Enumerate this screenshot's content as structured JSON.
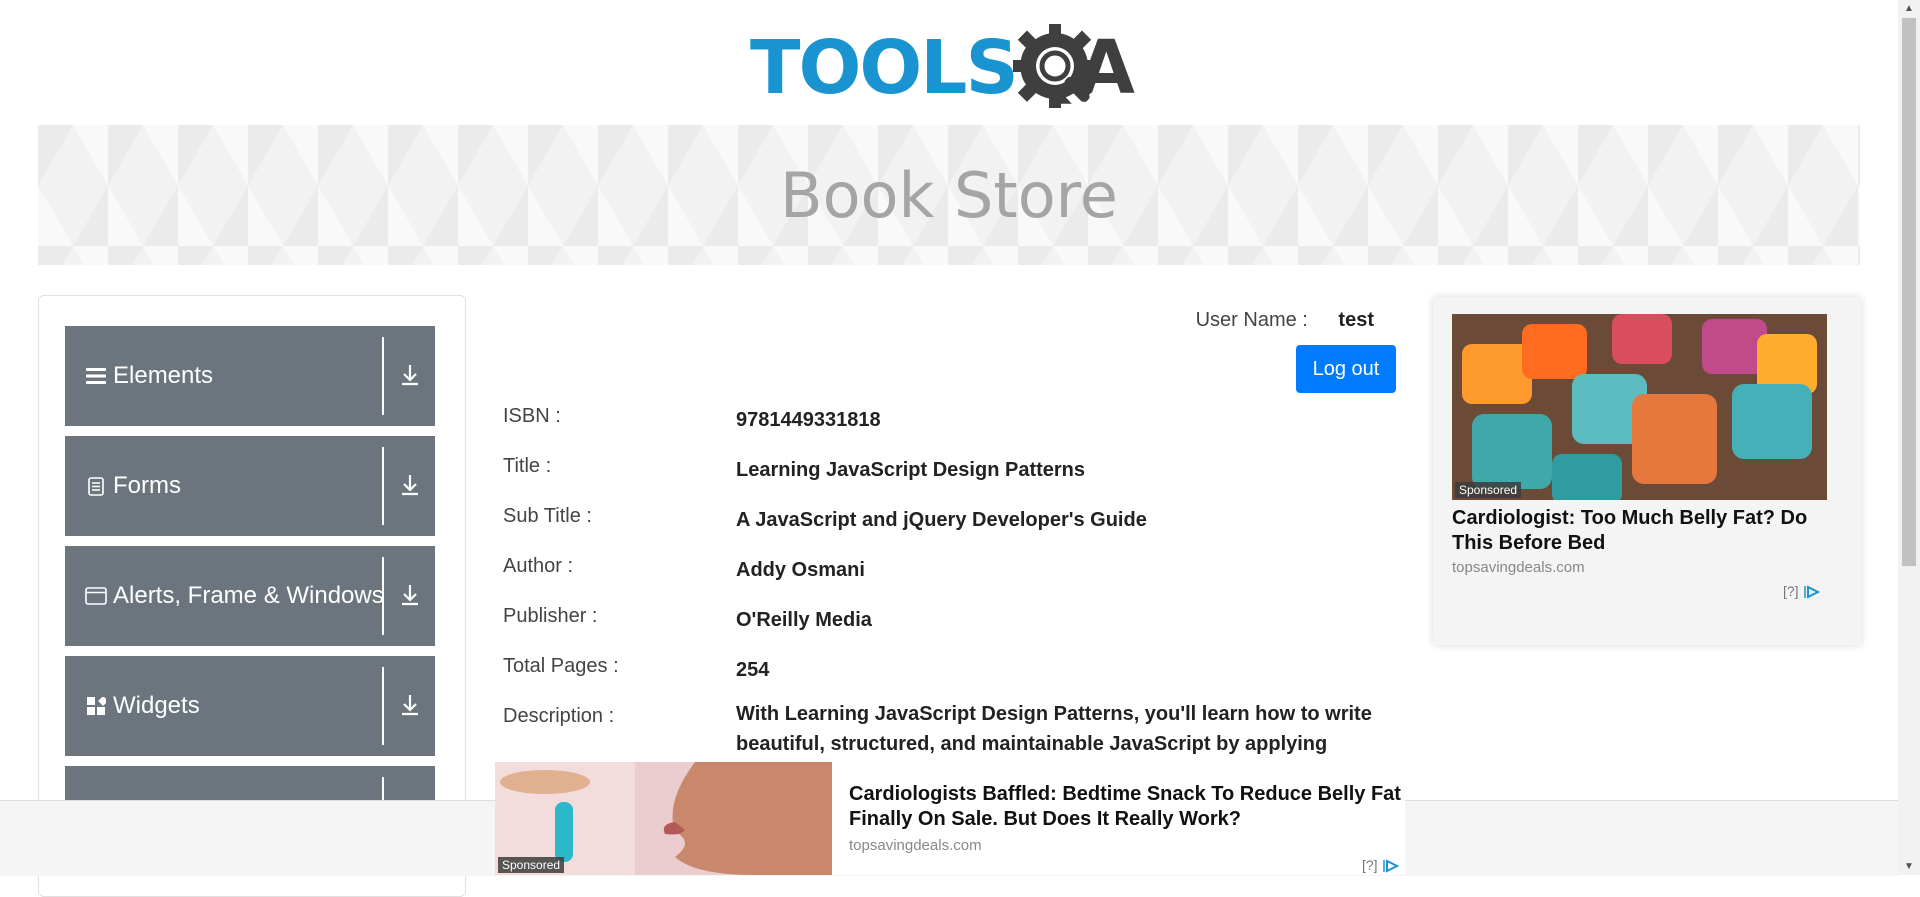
{
  "header": {
    "logo_text_main": "TOOLS",
    "logo_text_accent": "QA",
    "banner_title": "Book Store"
  },
  "sidebar": {
    "groups": [
      {
        "label": "Elements",
        "icon": "hamburger-icon"
      },
      {
        "label": "Forms",
        "icon": "document-icon"
      },
      {
        "label": "Alerts, Frame & Windows",
        "icon": "window-icon"
      },
      {
        "label": "Widgets",
        "icon": "widgets-icon"
      },
      {
        "label": "",
        "icon": ""
      }
    ]
  },
  "profile": {
    "username_label": "User Name :",
    "username_value": "test",
    "logout_label": "Log out"
  },
  "book": {
    "rows": [
      {
        "label": "ISBN :",
        "value": "9781449331818"
      },
      {
        "label": "Title :",
        "value": "Learning JavaScript Design Patterns"
      },
      {
        "label": "Sub Title :",
        "value": "A JavaScript and jQuery Developer's Guide"
      },
      {
        "label": "Author :",
        "value": "Addy Osmani"
      },
      {
        "label": "Publisher :",
        "value": "O'Reilly Media"
      },
      {
        "label": "Total Pages :",
        "value": "254"
      },
      {
        "label": "Description :",
        "value": "With Learning JavaScript Design Patterns, you'll learn how to write beautiful, structured, and maintainable JavaScript by applying classical"
      }
    ]
  },
  "ad_right": {
    "sponsored": "Sponsored",
    "title": "Cardiologist: Too Much Belly Fat? Do This Before Bed",
    "domain": "topsavingdeals.com",
    "info": "[?]"
  },
  "ad_bottom": {
    "sponsored": "Sponsored",
    "title": "Cardiologists Baffled: Bedtime Snack To Reduce Belly Fat Finally On Sale. But Does It Really Work?",
    "domain": "topsavingdeals.com",
    "info": "[?]"
  },
  "colors": {
    "accent": "#007bff",
    "sidebar_group": "#6c757d",
    "logo_blue": "#1a94d1",
    "logo_dark": "#3f3f40"
  }
}
